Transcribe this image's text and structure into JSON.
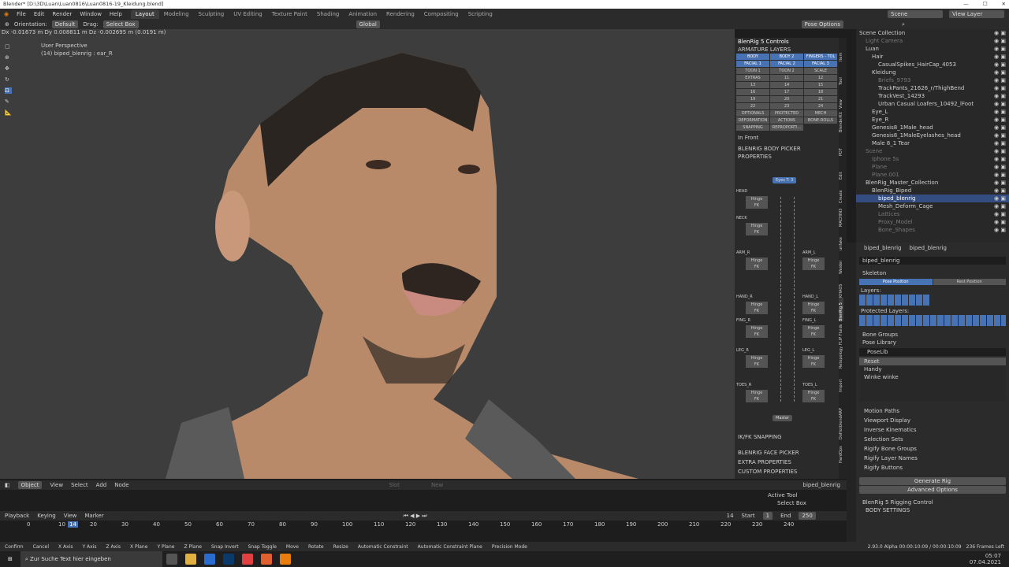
{
  "titlebar": {
    "title": "Blender* [D:\\3D\\Luan\\Luan0816\\Luan0816-19_Kleidung.blend]",
    "controls": [
      "—",
      "☐",
      "✕"
    ]
  },
  "menu": [
    "File",
    "Edit",
    "Render",
    "Window",
    "Help"
  ],
  "workspaces": [
    "Layout",
    "Modeling",
    "Sculpting",
    "UV Editing",
    "Texture Paint",
    "Shading",
    "Animation",
    "Rendering",
    "Compositing",
    "Scripting"
  ],
  "scene": {
    "label": "Scene",
    "view_layer": "View Layer"
  },
  "toolheader": {
    "orientation_label": "Orientation:",
    "orientation": "Default",
    "drag_label": "Drag:",
    "drag": "Select Box",
    "transform": "Global",
    "pose_options": "Pose Options"
  },
  "viewport": {
    "info": "Dx -0.01673 m  Dy 0.008811 m  Dz -0.002695 m (0.0191 m)",
    "perspective": "User Perspective",
    "object": "(14) biped_blenrig : ear_R"
  },
  "npanel": {
    "title": "BlenRig 5 Controls",
    "armature_layers": "ARMATURE LAYERS",
    "layer_rows": [
      [
        "BODY",
        "BODY 2",
        "FINGERS - TOL"
      ],
      [
        "FACIAL 1",
        "FACIAL 2",
        "FACIAL 3"
      ],
      [
        "TOON 1",
        "TOON 2",
        "SCALE"
      ],
      [
        "EXTRAS",
        "11",
        "12"
      ],
      [
        "13",
        "14",
        "15"
      ],
      [
        "16",
        "17",
        "18"
      ],
      [
        "19",
        "20",
        "21"
      ],
      [
        "22",
        "23",
        "24"
      ],
      [
        "OPTIONALS",
        "PROTECTED",
        "MECH"
      ],
      [
        "DEFORMATION",
        "ACTIONS",
        "BONE-ROLLS"
      ],
      [
        "SNAPPING",
        "REPROPORTI..."
      ]
    ],
    "in_front": "In Front",
    "body_picker": "BLENRIG BODY PICKER",
    "properties": "PROPERTIES",
    "eyes": "Eyes T: 3",
    "labels": [
      "HEAD",
      "NECK",
      "ARM_R",
      "ARM_L",
      "HAND_R",
      "HAND_L",
      "FING_R",
      "FING_L",
      "LEG_R",
      "LEG_L",
      "TOES_R",
      "TOES_L"
    ],
    "fk": "FK",
    "hinge": "Hinge",
    "str_ik": "Str IK",
    "ik": "IK",
    "master": "Master",
    "ikfk": "IK/FK SNAPPING",
    "face_picker": "BLENRIG FACE PICKER",
    "extra_props": "EXTRA PROPERTIES",
    "custom_props": "CUSTOM PROPERTIES"
  },
  "side_tabs": [
    "Item",
    "Tool",
    "View",
    "BlenderKit",
    "PDT",
    "Edit",
    "Create",
    "MACHIN3",
    "unfake",
    "Weider",
    "KHAOS",
    "BlenRig 5",
    "FLIP Fluids",
    "Retopology",
    "Import",
    "ARP",
    "DoHotblender",
    "HardOps"
  ],
  "outliner": {
    "items": [
      {
        "t": "Scene Collection",
        "d": 0
      },
      {
        "t": "Light Camera",
        "d": 1,
        "dim": true
      },
      {
        "t": "Luan",
        "d": 1
      },
      {
        "t": "Hair",
        "d": 2
      },
      {
        "t": "CasualSpikes_HairCap_4053",
        "d": 3
      },
      {
        "t": "Kleidung",
        "d": 2
      },
      {
        "t": "Briefs_9793",
        "d": 3,
        "dim": true
      },
      {
        "t": "TrackPants_21626_r/ThighBend",
        "d": 3
      },
      {
        "t": "TrackVest_14293",
        "d": 3
      },
      {
        "t": "Urban Casual Loafers_10492_lFoot",
        "d": 3
      },
      {
        "t": "Eye_L",
        "d": 2
      },
      {
        "t": "Eye_R",
        "d": 2
      },
      {
        "t": "Genesis8_1Male_head",
        "d": 2
      },
      {
        "t": "Genesis8_1MaleEyelashes_head",
        "d": 2
      },
      {
        "t": "Male 8_1 Tear",
        "d": 2
      },
      {
        "t": "Scene",
        "d": 1,
        "dim": true
      },
      {
        "t": "Iphone 5s",
        "d": 2,
        "dim": true
      },
      {
        "t": "Plane",
        "d": 2,
        "dim": true
      },
      {
        "t": "Plane.001",
        "d": 2,
        "dim": true
      },
      {
        "t": "BlenRig_Master_Collection",
        "d": 1
      },
      {
        "t": "BlenRig_Biped",
        "d": 2
      },
      {
        "t": "biped_blenrig",
        "d": 3,
        "sel": true
      },
      {
        "t": "Mesh_Deform_Cage",
        "d": 3
      },
      {
        "t": "Lattices",
        "d": 3,
        "dim": true
      },
      {
        "t": "Proxy_Model",
        "d": 3,
        "dim": true
      },
      {
        "t": "Bone_Shapes",
        "d": 3,
        "dim": true
      }
    ]
  },
  "props": {
    "breadcrumb": [
      "biped_blenrig",
      "biped_blenrig"
    ],
    "name": "biped_blenrig",
    "skeleton": "Skeleton",
    "pose_position": "Pose Position",
    "rest_position": "Rest Position",
    "layers": "Layers:",
    "protected_layers": "Protected Layers:",
    "bone_groups": "Bone Groups",
    "pose_library": "Pose Library",
    "poselib": "PoseLib",
    "poses": [
      "Reset",
      "Handy",
      "Winke winke"
    ],
    "sections": [
      "Motion Paths",
      "Viewport Display",
      "Inverse Kinematics",
      "Selection Sets",
      "Rigify Bone Groups",
      "Rigify Layer Names",
      "Rigify Buttons"
    ],
    "generate": "Generate Rig",
    "advanced": "Advanced Options",
    "blenrig_rigging": "BlenRig 5 Rigging Control",
    "body_settings": "BODY SETTINGS",
    "version": "2.93.0 Alpha  00:00:10:09 / 00:00:10:09",
    "frames": "236 Frames Left"
  },
  "node_header": {
    "object": "Object",
    "view": "View",
    "select": "Select",
    "add": "Add",
    "node": "Node",
    "slot": "Slot",
    "new": "New",
    "name": "biped_blenrig",
    "active_tool": "Active Tool",
    "select_box": "Select Box"
  },
  "timeline": {
    "playback": "Playback",
    "keying": "Keying",
    "view": "View",
    "marker": "Marker",
    "current": "14",
    "start_label": "Start",
    "start": "1",
    "end_label": "End",
    "end": "250",
    "ticks": [
      "0",
      "10",
      "20",
      "30",
      "40",
      "50",
      "60",
      "70",
      "80",
      "90",
      "100",
      "110",
      "120",
      "130",
      "140",
      "150",
      "160",
      "170",
      "180",
      "190",
      "200",
      "210",
      "220",
      "230",
      "240"
    ]
  },
  "status": [
    "Confirm",
    "Cancel",
    "X Axis",
    "Y Axis",
    "Z Axis",
    "X Plane",
    "Y Plane",
    "Z Plane",
    "Snap Invert",
    "Snap Toggle",
    "Move",
    "Rotate",
    "Resize",
    "Automatic Constraint",
    "Automatic Constraint Plane",
    "Precision Mode"
  ],
  "taskbar": {
    "search": "Zur Suche Text hier eingeben",
    "time": "05:07",
    "date": "07.04.2021"
  }
}
